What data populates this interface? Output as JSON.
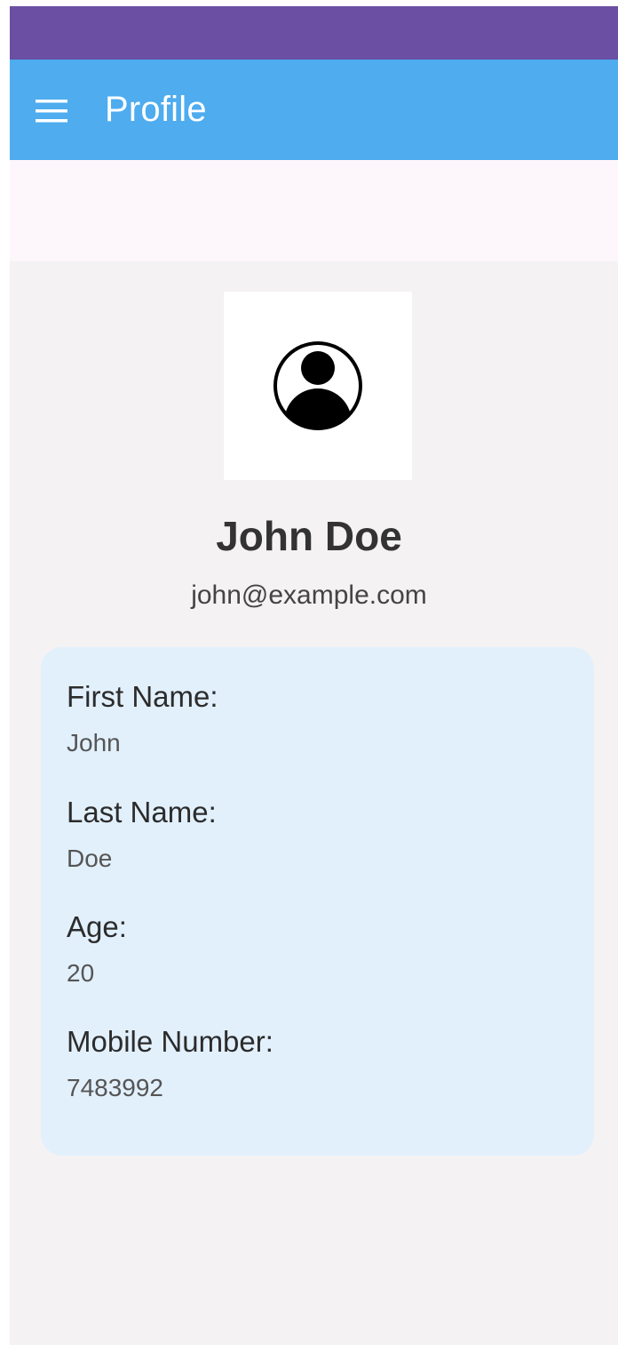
{
  "app_bar": {
    "title": "Profile",
    "menu_icon": "hamburger-menu-icon"
  },
  "colors": {
    "status_bar": "#6a4fa3",
    "app_bar": "#4eacef",
    "card": "#e2f0fc",
    "background": "#f4f2f3"
  },
  "profile": {
    "avatar_icon": "account-circle-icon",
    "name": "John Doe",
    "email": "john@example.com"
  },
  "details": [
    {
      "label": "First Name:",
      "value": "John"
    },
    {
      "label": "Last Name:",
      "value": "Doe"
    },
    {
      "label": "Age:",
      "value": "20"
    },
    {
      "label": "Mobile Number:",
      "value": "7483992"
    }
  ]
}
